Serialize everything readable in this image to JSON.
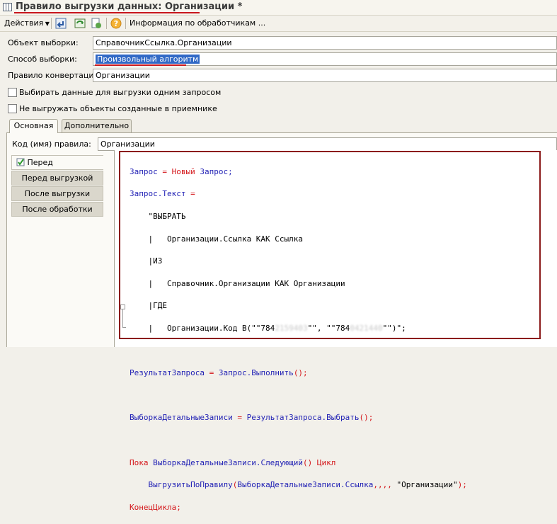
{
  "window": {
    "title": "Правило выгрузки данных: Организации *"
  },
  "toolbar": {
    "actions_label": "Действия",
    "info_label": "Информация по обработчикам ..."
  },
  "form": {
    "object_label": "Объект выборки:",
    "object_value": "СправочникСсылка.Организации",
    "method_label": "Способ выборки:",
    "method_value": "Произвольный алгоритм",
    "conversion_label": "Правило конвертации:",
    "conversion_value": "Организации",
    "checkbox1_label": "Выбирать данные для выгрузки одним запросом",
    "checkbox2_label": "Не выгружать объекты созданные в приемнике"
  },
  "tabs": [
    {
      "label": "Основная"
    },
    {
      "label": "Дополнительно"
    }
  ],
  "code_name": {
    "label": "Код (имя) правила:",
    "value": "Организации"
  },
  "side_tabs": [
    {
      "label": "Перед обработкой"
    },
    {
      "label": "Перед выгрузкой"
    },
    {
      "label": "После выгрузки"
    },
    {
      "label": "После обработки"
    }
  ],
  "code": {
    "l1a": "Запрос",
    "l1b": " = ",
    "l1c": "Новый",
    "l1d": " Запрос;",
    "l2a": "Запрос.Текст",
    "l2b": " =",
    "l3": "    \"ВЫБРАТЬ",
    "l4": "    |   Организации.Ссылка КАК Ссылка",
    "l5": "    |ИЗ",
    "l6": "    |   Справочник.Организации КАК Организации",
    "l7": "    |ГДЕ",
    "l8a": "    |   Организации.Код В(\"\"784",
    "l8b": "2159403",
    "l8c": "\"\", \"\"784",
    "l8d": "0421440",
    "l8e": "\"\")\";",
    "l9a": "РезультатЗапроса",
    "l9b": " = ",
    "l9c": "Запрос.Выполнить",
    "l9d": "();",
    "l10a": "ВыборкаДетальныеЗаписи",
    "l10b": " = ",
    "l10c": "РезультатЗапроса.Выбрать",
    "l10d": "();",
    "l11a": "Пока",
    "l11b": " ВыборкаДетальныеЗаписи.Следующий",
    "l11c": "() ",
    "l11d": "Цикл",
    "l12a": "    ВыгрузитьПоПравилу",
    "l12b": "(",
    "l12c": "ВыборкаДетальныеЗаписи.Ссылка",
    "l12d": ",,,, ",
    "l12e": "\"Организации\"",
    "l12f": ");",
    "l13": "КонецЦикла;"
  }
}
